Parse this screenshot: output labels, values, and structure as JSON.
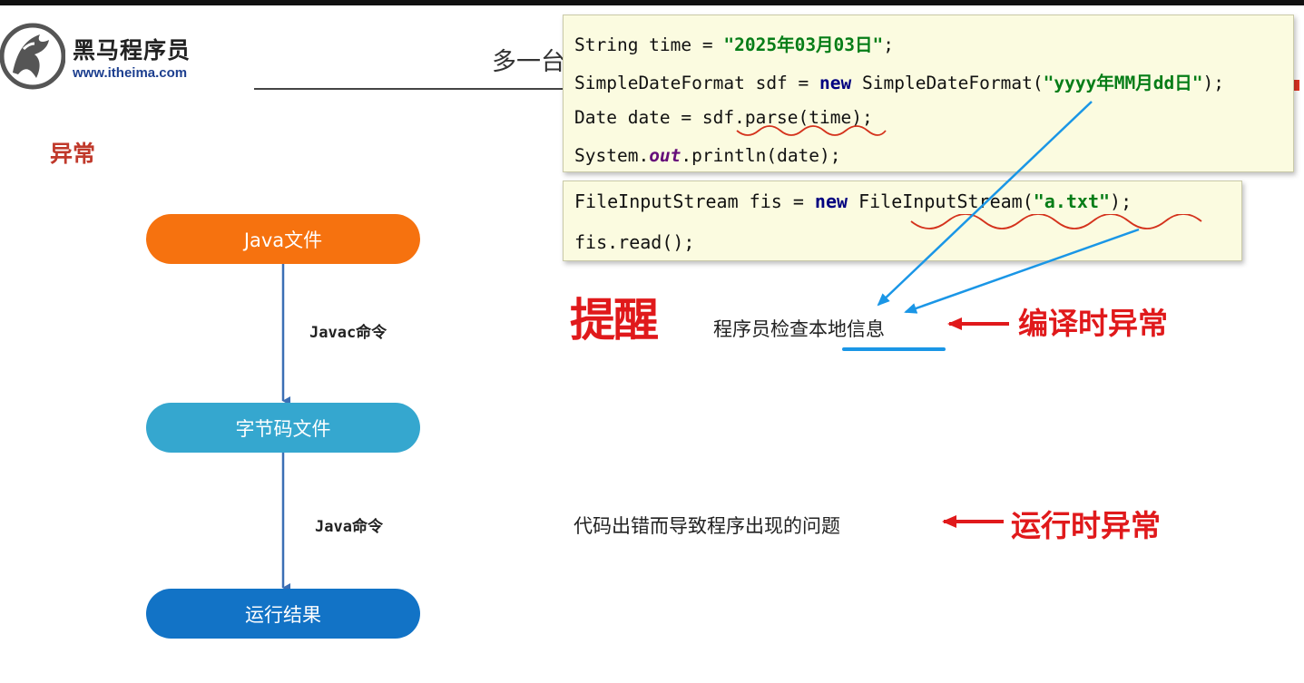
{
  "logo": {
    "name_cn": "黑马程序员",
    "url": "www.itheima.com"
  },
  "header": {
    "title": "多一台",
    "trailing": "!"
  },
  "section": {
    "title": "异常"
  },
  "flow": {
    "nodes": [
      "Java文件",
      "字节码文件",
      "运行结果"
    ],
    "commands": [
      "Javac命令",
      "Java命令"
    ]
  },
  "code_box_1": {
    "lines": [
      [
        {
          "t": "String time = "
        },
        {
          "t": "\"2025年03月03日\"",
          "c": "str"
        },
        {
          "t": ";"
        }
      ],
      [
        {
          "t": "SimpleDateFormat sdf = "
        },
        {
          "t": "new",
          "c": "kw"
        },
        {
          "t": " SimpleDateFormat("
        },
        {
          "t": "\"yyyy年MM月dd日\"",
          "c": "str"
        },
        {
          "t": ");"
        }
      ],
      [
        {
          "t": "Date date = sdf.parse(time);"
        }
      ],
      [
        {
          "t": "System."
        },
        {
          "t": "out",
          "c": "fld"
        },
        {
          "t": ".println(date);"
        }
      ]
    ]
  },
  "code_box_2": {
    "lines": [
      [
        {
          "t": "FileInputStream fis = "
        },
        {
          "t": "new",
          "c": "kw"
        },
        {
          "t": " FileInputStream("
        },
        {
          "t": "\"a.txt\"",
          "c": "str"
        },
        {
          "t": ");"
        }
      ],
      [
        {
          "t": "fis.read();"
        }
      ]
    ]
  },
  "annotations": {
    "remind_big": "提醒",
    "remind_text": "程序员检查本地信息",
    "compile_label": "编译时异常",
    "runtime_desc": "代码出错而导致程序出现的问题",
    "runtime_label": "运行时异常"
  },
  "colors": {
    "java_node": "#f6720f",
    "bytecode_node": "#35a7cf",
    "result_node": "#1273c6",
    "accent_red": "#e0191b",
    "pointer_blue": "#1a96e6",
    "code_bg": "#fbfbe0"
  }
}
